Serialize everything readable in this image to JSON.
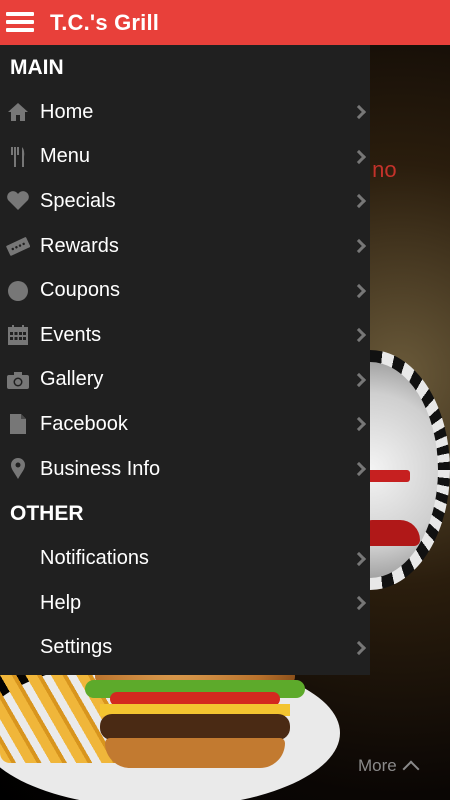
{
  "app": {
    "title": "T.C.'s Grill"
  },
  "background": {
    "partial_text": "k no",
    "more_label": "More"
  },
  "drawer": {
    "sections": [
      {
        "header": "MAIN",
        "items": [
          {
            "label": "Home",
            "icon": "home-icon"
          },
          {
            "label": "Menu",
            "icon": "fork-knife-icon"
          },
          {
            "label": "Specials",
            "icon": "heart-icon"
          },
          {
            "label": "Rewards",
            "icon": "ticket-icon"
          },
          {
            "label": "Coupons",
            "icon": "circle-icon"
          },
          {
            "label": "Events",
            "icon": "calendar-icon"
          },
          {
            "label": "Gallery",
            "icon": "camera-icon"
          },
          {
            "label": "Facebook",
            "icon": "page-icon"
          },
          {
            "label": "Business Info",
            "icon": "map-pin-icon"
          }
        ]
      },
      {
        "header": "OTHER",
        "items": [
          {
            "label": "Notifications"
          },
          {
            "label": "Help"
          },
          {
            "label": "Settings"
          }
        ]
      }
    ]
  },
  "colors": {
    "app_bar": "#e8403a",
    "drawer_bg": "#202020",
    "icon_gray": "#777777"
  }
}
